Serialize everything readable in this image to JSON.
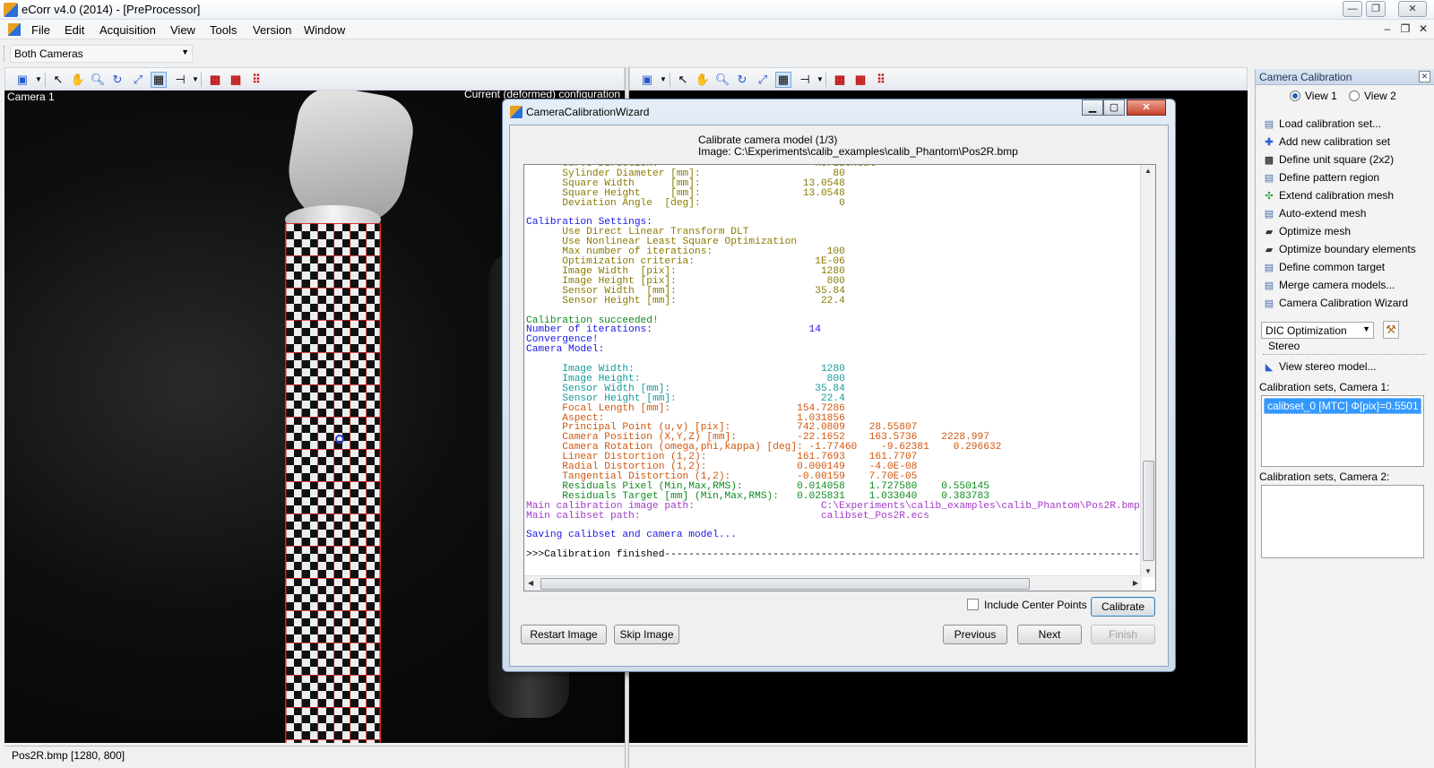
{
  "window": {
    "title": "eCorr v4.0 (2014) - [PreProcessor]",
    "min": "—",
    "max": "❐",
    "close": "✕"
  },
  "menu": [
    "File",
    "Edit",
    "Acquisition",
    "View",
    "Tools",
    "Version",
    "Window"
  ],
  "mdi": {
    "min": "–",
    "restore": "❐",
    "close": "✕"
  },
  "camera_select": "Both Cameras",
  "left_view": {
    "label": "Camera 1",
    "config": "Current (deformed) configuration",
    "status": "Pos2R.bmp [1280, 800]"
  },
  "right_view": {
    "status": ""
  },
  "panel": {
    "title": "Camera Calibration",
    "view1": "View 1",
    "view2": "View 2",
    "items": [
      {
        "label": "Load calibration set...",
        "icon": "load-icon"
      },
      {
        "label": "Add new calibration set",
        "icon": "add-icon"
      },
      {
        "label": "Define unit square (2x2)",
        "icon": "checker-icon"
      },
      {
        "label": "Define pattern region",
        "icon": "region-icon"
      },
      {
        "label": "Extend calibration mesh",
        "icon": "extend-icon"
      },
      {
        "label": "Auto-extend mesh",
        "icon": "autoextend-icon"
      },
      {
        "label": "Optimize mesh",
        "icon": "optimize-icon"
      },
      {
        "label": "Optimize boundary elements",
        "icon": "boundary-icon"
      },
      {
        "label": "Define common target",
        "icon": "target-icon"
      },
      {
        "label": "Merge camera models...",
        "icon": "merge-icon"
      },
      {
        "label": "Camera Calibration Wizard",
        "icon": "wizard-icon"
      }
    ],
    "dic_select": "DIC Optimization",
    "stereo_label": "Stereo",
    "stereo_item": "View stereo model...",
    "sets1_label": "Calibration sets, Camera 1:",
    "sets1_item": "calibset_0 [MTC] Φ[pix]=0.5501",
    "sets2_label": "Calibration sets, Camera 2:"
  },
  "wizard": {
    "title": "CameraCalibrationWizard",
    "step": "Calibrate camera model (1/3)",
    "image": "Image: C:\\Experiments\\calib_examples\\calib_Phantom\\Pos2R.bmp",
    "include_center": "Include Center Points",
    "calibrate": "Calibrate",
    "restart": "Restart Image",
    "skip": "Skip Image",
    "previous": "Previous",
    "next": "Next",
    "finish": "Finish"
  },
  "console_lines": [
    {
      "t": "      Curve Direction:                          Horizontal",
      "c": "olive"
    },
    {
      "t": "      Sylinder Diameter [mm]:                      80",
      "c": "olive"
    },
    {
      "t": "      Square Width      [mm]:                 13.0548",
      "c": "olive"
    },
    {
      "t": "      Square Height     [mm]:                 13.0548",
      "c": "olive"
    },
    {
      "t": "      Deviation Angle  [deg]:                       0",
      "c": "olive"
    },
    {
      "t": "",
      "c": "dk"
    },
    {
      "t": "Calibration Settings:",
      "c": "blue"
    },
    {
      "t": "      Use Direct Linear Transform DLT",
      "c": "olive"
    },
    {
      "t": "      Use Nonlinear Least Square Optimization",
      "c": "olive"
    },
    {
      "t": "      Max number of iterations:                   100",
      "c": "olive"
    },
    {
      "t": "      Optimization criteria:                    1E-06",
      "c": "olive"
    },
    {
      "t": "      Image Width  [pix]:                        1280",
      "c": "olive"
    },
    {
      "t": "      Image Height [pix]:                         800",
      "c": "olive"
    },
    {
      "t": "      Sensor Width  [mm]:                       35.84",
      "c": "olive"
    },
    {
      "t": "      Sensor Height [mm]:                        22.4",
      "c": "olive"
    },
    {
      "t": "",
      "c": "dk"
    },
    {
      "t": "Calibration succeeded!",
      "c": "green"
    },
    {
      "t": "Number of iterations:                          14",
      "c": "blue"
    },
    {
      "t": "Convergence!",
      "c": "blue"
    },
    {
      "t": "Camera Model:",
      "c": "blue"
    },
    {
      "t": "",
      "c": "dk"
    },
    {
      "t": "      Image Width:                               1280",
      "c": "teal"
    },
    {
      "t": "      Image Height:                               800",
      "c": "teal"
    },
    {
      "t": "      Sensor Width [mm]:                        35.84",
      "c": "teal"
    },
    {
      "t": "      Sensor Height [mm]:                        22.4",
      "c": "teal"
    },
    {
      "t": "      Focal Length [mm]:                     154.7286",
      "c": "orange"
    },
    {
      "t": "      Aspect:                                1.031856",
      "c": "orange"
    },
    {
      "t": "      Principal Point (u,v) [pix]:           742.0809    28.55807",
      "c": "orange"
    },
    {
      "t": "      Camera Position (X,Y,Z) [mm]:          -22.1652    163.5736    2228.997",
      "c": "orange"
    },
    {
      "t": "      Camera Rotation (omega,phi,kappa) [deg]: -1.77460    -9.62381    0.296632",
      "c": "orange"
    },
    {
      "t": "      Linear Distortion (1,2):               161.7693    161.7707",
      "c": "orange"
    },
    {
      "t": "      Radial Distortion (1,2):               0.000149    -4.0E-08",
      "c": "orange"
    },
    {
      "t": "      Tangential Distortion (1,2):           -0.00159    7.70E-05",
      "c": "orange"
    },
    {
      "t": "      Residuals Pixel (Min,Max,RMS):         0.014058    1.727580    0.550145",
      "c": "green"
    },
    {
      "t": "      Residuals Target [mm] (Min,Max,RMS):   0.025831    1.033040    0.383783",
      "c": "green"
    },
    {
      "t": "Main calibration image path:                     C:\\Experiments\\calib_examples\\calib_Phantom\\Pos2R.bmp",
      "c": "purple"
    },
    {
      "t": "Main calibset path:                              calibset_Pos2R.ecs",
      "c": "purple"
    },
    {
      "t": "",
      "c": "dk"
    },
    {
      "t": "Saving calibset and camera model...",
      "c": "blue"
    },
    {
      "t": "",
      "c": "dk"
    },
    {
      "t": ">>>Calibration finished---------------------------------------------------------------------------------------",
      "c": "dk"
    }
  ]
}
